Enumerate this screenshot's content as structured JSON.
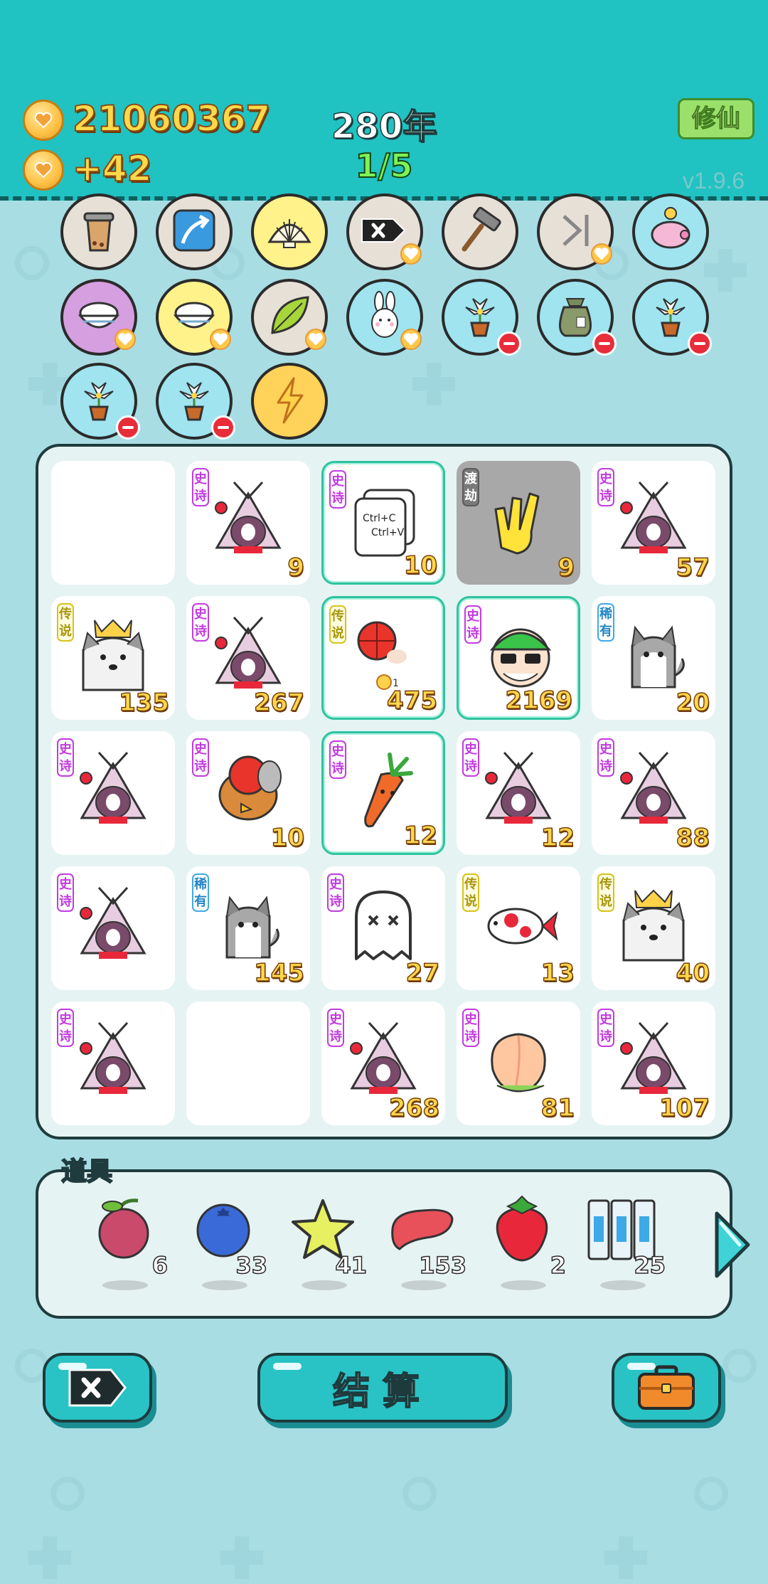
{
  "header": {
    "coins": "21060367",
    "income": "+42",
    "year": "280年",
    "page": "1/5",
    "xiuxian_label": "修仙",
    "version": "v1.9.6"
  },
  "abilities": [
    {
      "icon": "bubble-tea-icon",
      "color": "#e7e0d6",
      "badge": "none"
    },
    {
      "icon": "arrow-up-right-icon",
      "color": "#e7e0d6",
      "badge": "none"
    },
    {
      "icon": "shell-icon",
      "color": "#fff28a",
      "badge": "none"
    },
    {
      "icon": "delete-tag-icon",
      "color": "#e7e0d6",
      "badge": "heart"
    },
    {
      "icon": "hammer-icon",
      "color": "#e7e0d6",
      "badge": "none"
    },
    {
      "icon": "skip-forward-icon",
      "color": "#e7e0d6",
      "badge": "heart"
    },
    {
      "icon": "piggy-bank-icon",
      "color": "#9fe4ef",
      "badge": "none"
    },
    {
      "icon": "rice-bowl-icon",
      "color": "#d59fe0",
      "badge": "heart"
    },
    {
      "icon": "rice-bowl-icon",
      "color": "#fff28a",
      "badge": "heart"
    },
    {
      "icon": "leaf-icon",
      "color": "#e7e0d6",
      "badge": "heart"
    },
    {
      "icon": "bunny-icon",
      "color": "#9fe4ef",
      "badge": "heart"
    },
    {
      "icon": "flower-pot-icon",
      "color": "#9fe4ef",
      "badge": "minus"
    },
    {
      "icon": "sack-icon",
      "color": "#9fe4ef",
      "badge": "minus"
    },
    {
      "icon": "flower-pot-icon",
      "color": "#9fe4ef",
      "badge": "minus"
    },
    {
      "icon": "flower-pot-icon",
      "color": "#9fe4ef",
      "badge": "minus"
    },
    {
      "icon": "flower-pot-icon",
      "color": "#9fe4ef",
      "badge": "minus"
    },
    {
      "icon": "lightning-icon",
      "color": "#ffd25a",
      "badge": "none"
    }
  ],
  "board": [
    {
      "item": "empty",
      "tag": "",
      "count": ""
    },
    {
      "item": "bunny-house",
      "tag": "史诗",
      "count": "9"
    },
    {
      "item": "copy-paste",
      "tag": "史诗",
      "count": "10",
      "highlight": true
    },
    {
      "item": "rock-hand",
      "tag": "渡劫",
      "count": "9",
      "gray": true
    },
    {
      "item": "bunny-house",
      "tag": "史诗",
      "count": "57"
    },
    {
      "item": "husky-king",
      "tag": "传说",
      "count": "135"
    },
    {
      "item": "bunny-house",
      "tag": "史诗",
      "count": "267"
    },
    {
      "item": "basketball",
      "tag": "传说",
      "count": "475",
      "highlight": true
    },
    {
      "item": "sunglasses-guy",
      "tag": "史诗",
      "count": "2169",
      "highlight": true
    },
    {
      "item": "husky",
      "tag": "稀有",
      "count": "20"
    },
    {
      "item": "bunny-house",
      "tag": "史诗",
      "count": ""
    },
    {
      "item": "angry-bird",
      "tag": "史诗",
      "count": "10"
    },
    {
      "item": "carrot",
      "tag": "史诗",
      "count": "12",
      "highlight": true
    },
    {
      "item": "bunny-house",
      "tag": "史诗",
      "count": "12"
    },
    {
      "item": "bunny-house",
      "tag": "史诗",
      "count": "88"
    },
    {
      "item": "bunny-house",
      "tag": "史诗",
      "count": ""
    },
    {
      "item": "husky",
      "tag": "稀有",
      "count": "145"
    },
    {
      "item": "ghost",
      "tag": "史诗",
      "count": "27"
    },
    {
      "item": "koi-fish",
      "tag": "传说",
      "count": "13"
    },
    {
      "item": "husky-king",
      "tag": "传说",
      "count": "40"
    },
    {
      "item": "bunny-house",
      "tag": "史诗",
      "count": ""
    },
    {
      "item": "empty",
      "tag": "",
      "count": ""
    },
    {
      "item": "bunny-house",
      "tag": "史诗",
      "count": "268"
    },
    {
      "item": "peach",
      "tag": "史诗",
      "count": "81"
    },
    {
      "item": "bunny-house",
      "tag": "史诗",
      "count": "107"
    }
  ],
  "props": {
    "label": "道具",
    "items": [
      {
        "icon": "lychee-icon",
        "count": "6"
      },
      {
        "icon": "blueberry-icon",
        "count": "33"
      },
      {
        "icon": "star-icon",
        "count": "41"
      },
      {
        "icon": "liver-icon",
        "count": "153"
      },
      {
        "icon": "strawberry-icon",
        "count": "2"
      },
      {
        "icon": "rare-cards-icon",
        "count": "25"
      }
    ]
  },
  "buttons": {
    "settle_label": "结算"
  },
  "rare_card_text": "稀有"
}
